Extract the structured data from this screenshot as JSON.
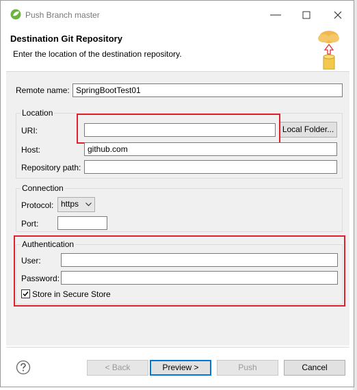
{
  "window": {
    "title": "Push Branch master"
  },
  "banner": {
    "title": "Destination Git Repository",
    "description": "Enter the location of the destination repository."
  },
  "remote": {
    "label": "Remote name:",
    "value": "SpringBootTest01"
  },
  "location": {
    "legend": "Location",
    "uri_label": "URI:",
    "uri_value": "",
    "local_folder_button": "Local Folder...",
    "host_label": "Host:",
    "host_value": "github.com",
    "repo_path_label": "Repository path:",
    "repo_path_value": ""
  },
  "connection": {
    "legend": "Connection",
    "protocol_label": "Protocol:",
    "protocol_value": "https",
    "port_label": "Port:",
    "port_value": ""
  },
  "authentication": {
    "legend": "Authentication",
    "user_label": "User:",
    "user_value": "",
    "password_label": "Password:",
    "password_value": "",
    "secure_store_label": "Store in Secure Store",
    "secure_store_checked": true
  },
  "footer": {
    "back": "< Back",
    "preview": "Preview >",
    "push": "Push",
    "cancel": "Cancel"
  },
  "colors": {
    "highlight": "#e0202f",
    "focus": "#0078d7"
  },
  "icons": [
    "eclipse-icon",
    "minimize-icon",
    "maximize-icon",
    "close-icon",
    "cloud-push-icon",
    "help-icon",
    "chevron-down-icon",
    "checkbox-checked-icon"
  ]
}
